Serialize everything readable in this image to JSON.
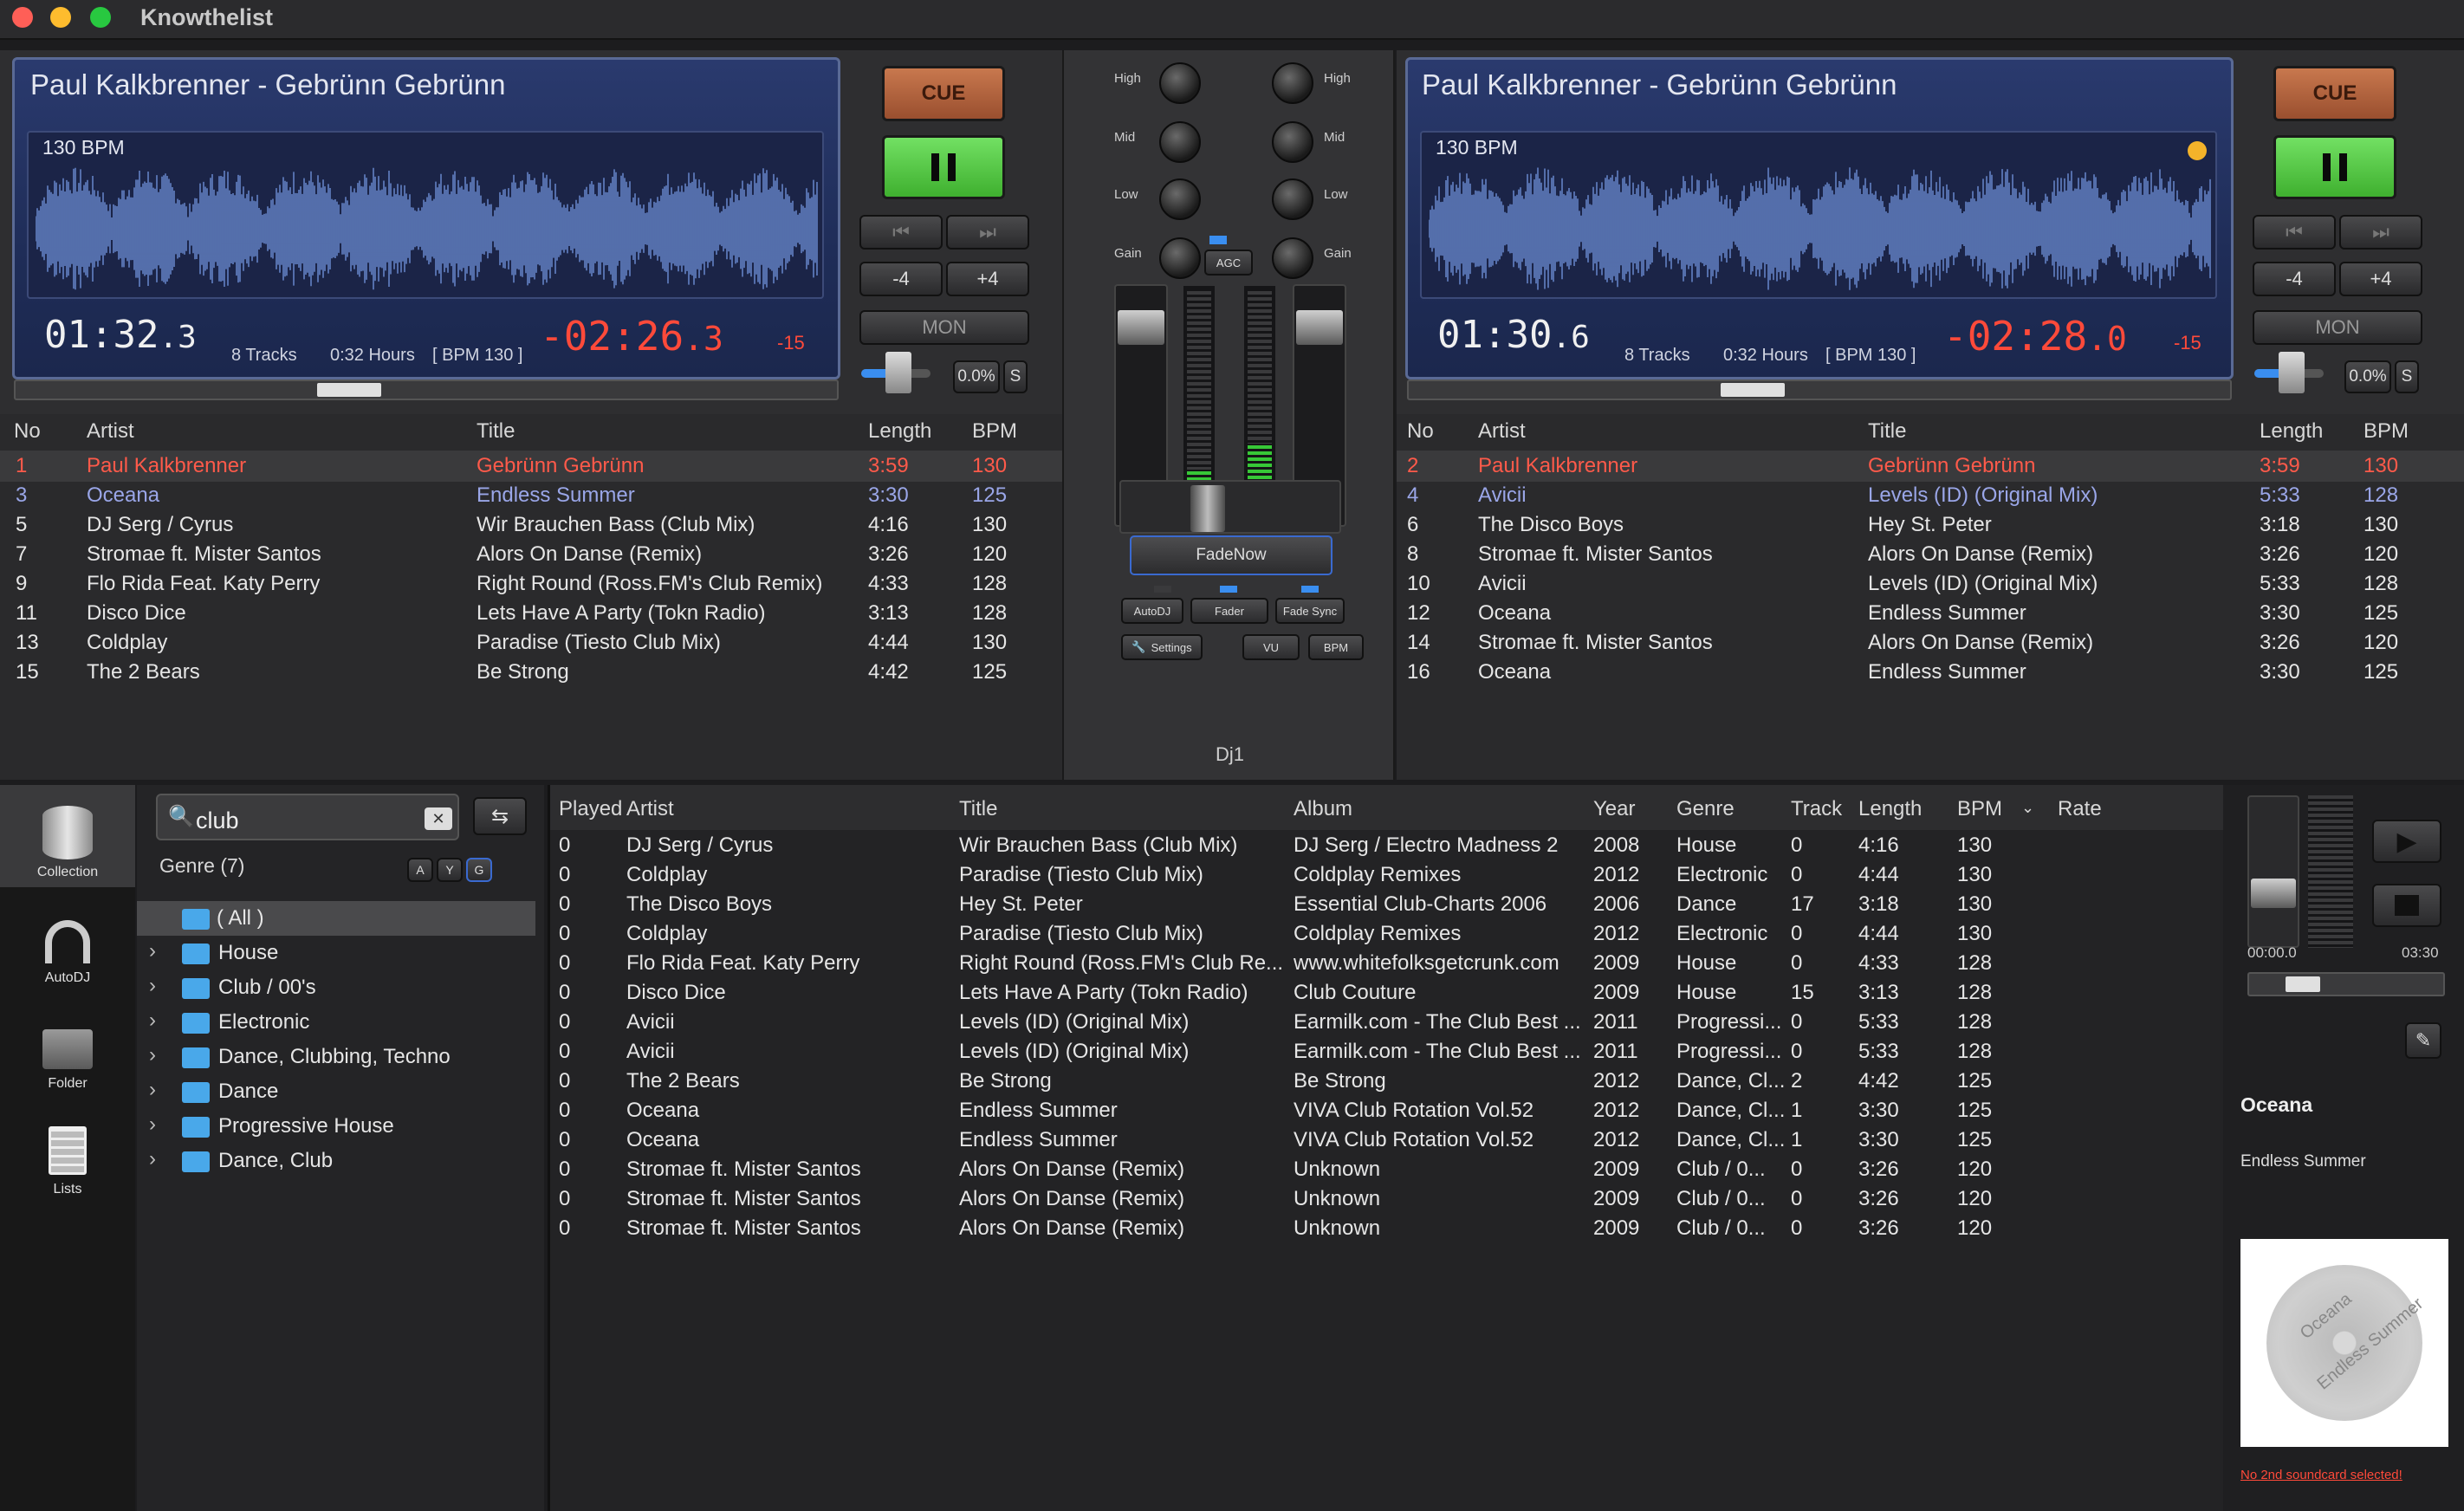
{
  "app": {
    "title": "Knowthelist"
  },
  "colors": {
    "accent_red": "#ff4a3a",
    "lcd_blue": "#22336a",
    "play_green": "#5ccc4c",
    "cue_orange": "#b8643f",
    "folder_blue": "#49a8ea"
  },
  "deck1": {
    "title": "Paul Kalkbrenner - Gebrünn Gebrünn",
    "bpm": "130 BPM",
    "elapsed": "01:32",
    "elapsed_frac": ".3",
    "tracks": "8 Tracks",
    "hours": "0:32 Hours",
    "bpm_tag": "[ BPM 130 ]",
    "remaining": "-02:26",
    "remaining_frac": ".3",
    "pitch_offset": "-15",
    "cue_label": "CUE",
    "minus_label": "-4",
    "plus_label": "+4",
    "mon_label": "MON",
    "pitch_value": "0.0%",
    "sync_label": "S"
  },
  "deck2": {
    "title": "Paul Kalkbrenner - Gebrünn Gebrünn",
    "bpm": "130 BPM",
    "elapsed": "01:30",
    "elapsed_frac": ".6",
    "tracks": "8 Tracks",
    "hours": "0:32 Hours",
    "bpm_tag": "[ BPM 130 ]",
    "remaining": "-02:28",
    "remaining_frac": ".0",
    "pitch_offset": "-15",
    "cue_label": "CUE",
    "minus_label": "-4",
    "plus_label": "+4",
    "mon_label": "MON",
    "pitch_value": "0.0%",
    "sync_label": "S"
  },
  "playlist_headers": {
    "no": "No",
    "artist": "Artist",
    "title": "Title",
    "length": "Length",
    "bpm": "BPM"
  },
  "playlist1": [
    {
      "no": "1",
      "artist": "Paul Kalkbrenner",
      "title": "Gebrünn Gebrünn",
      "length": "3:59",
      "bpm": "130",
      "state": "playing"
    },
    {
      "no": "3",
      "artist": "Oceana",
      "title": "Endless Summer",
      "length": "3:30",
      "bpm": "125",
      "state": "next"
    },
    {
      "no": "5",
      "artist": "DJ Serg / Cyrus",
      "title": "Wir Brauchen Bass (Club Mix)",
      "length": "4:16",
      "bpm": "130",
      "state": ""
    },
    {
      "no": "7",
      "artist": "Stromae ft. Mister Santos",
      "title": "Alors On Danse (Remix)",
      "length": "3:26",
      "bpm": "120",
      "state": ""
    },
    {
      "no": "9",
      "artist": "Flo Rida Feat. Katy Perry",
      "title": "Right Round (Ross.FM's Club Remix)",
      "length": "4:33",
      "bpm": "128",
      "state": ""
    },
    {
      "no": "11",
      "artist": "Disco Dice",
      "title": "Lets Have A Party (Tokn Radio)",
      "length": "3:13",
      "bpm": "128",
      "state": ""
    },
    {
      "no": "13",
      "artist": "Coldplay",
      "title": "Paradise (Tiesto Club Mix)",
      "length": "4:44",
      "bpm": "130",
      "state": ""
    },
    {
      "no": "15",
      "artist": "The 2 Bears",
      "title": "Be Strong",
      "length": "4:42",
      "bpm": "125",
      "state": ""
    }
  ],
  "playlist2": [
    {
      "no": "2",
      "artist": "Paul Kalkbrenner",
      "title": "Gebrünn Gebrünn",
      "length": "3:59",
      "bpm": "130",
      "state": "playing"
    },
    {
      "no": "4",
      "artist": "Avicii",
      "title": "Levels (ID) (Original Mix)",
      "length": "5:33",
      "bpm": "128",
      "state": "next"
    },
    {
      "no": "6",
      "artist": "The Disco Boys",
      "title": "Hey St. Peter",
      "length": "3:18",
      "bpm": "130",
      "state": ""
    },
    {
      "no": "8",
      "artist": "Stromae ft. Mister Santos",
      "title": "Alors On Danse (Remix)",
      "length": "3:26",
      "bpm": "120",
      "state": ""
    },
    {
      "no": "10",
      "artist": "Avicii",
      "title": "Levels (ID) (Original Mix)",
      "length": "5:33",
      "bpm": "128",
      "state": ""
    },
    {
      "no": "12",
      "artist": "Oceana",
      "title": "Endless Summer",
      "length": "3:30",
      "bpm": "125",
      "state": ""
    },
    {
      "no": "14",
      "artist": "Stromae ft. Mister Santos",
      "title": "Alors On Danse (Remix)",
      "length": "3:26",
      "bpm": "120",
      "state": ""
    },
    {
      "no": "16",
      "artist": "Oceana",
      "title": "Endless Summer",
      "length": "3:30",
      "bpm": "125",
      "state": ""
    }
  ],
  "mixer": {
    "high": "High",
    "mid": "Mid",
    "low": "Low",
    "gain": "Gain",
    "agc": "AGC",
    "fadenow": "FadeNow",
    "autodj": "AutoDJ",
    "fader": "Fader",
    "fadesync": "Fade Sync",
    "settings": "Settings",
    "vu": "VU",
    "bpm": "BPM",
    "name": "Dj1"
  },
  "sidebar": [
    {
      "label": "Collection",
      "icon": "database-icon"
    },
    {
      "label": "AutoDJ",
      "icon": "headphones-icon"
    },
    {
      "label": "Folder",
      "icon": "folder-icon"
    },
    {
      "label": "Lists",
      "icon": "list-icon"
    }
  ],
  "search": {
    "value": "club"
  },
  "genre": {
    "label": "Genre  (7)",
    "sort_buttons": [
      "A",
      "Y",
      "G"
    ],
    "items": [
      "( All )",
      "House",
      "Club / 00's",
      "Electronic",
      "Dance, Clubbing, Techno",
      "Dance",
      "Progressive House",
      "Dance, Club"
    ]
  },
  "library_headers": {
    "played": "Played",
    "artist": "Artist",
    "title": "Title",
    "album": "Album",
    "year": "Year",
    "genre": "Genre",
    "track": "Track",
    "length": "Length",
    "bpm": "BPM",
    "rate": "Rate"
  },
  "library": [
    [
      "0",
      "DJ Serg / Cyrus",
      "Wir Brauchen Bass (Club Mix)",
      "DJ Serg / Electro Madness 2",
      "2008",
      "House",
      "0",
      "4:16",
      "130"
    ],
    [
      "0",
      "Coldplay",
      "Paradise (Tiesto Club Mix)",
      "Coldplay Remixes",
      "2012",
      "Electronic",
      "0",
      "4:44",
      "130"
    ],
    [
      "0",
      "The Disco Boys",
      "Hey St. Peter",
      "Essential Club-Charts 2006",
      "2006",
      "Dance",
      "17",
      "3:18",
      "130"
    ],
    [
      "0",
      "Coldplay",
      "Paradise (Tiesto Club Mix)",
      "Coldplay Remixes",
      "2012",
      "Electronic",
      "0",
      "4:44",
      "130"
    ],
    [
      "0",
      "Flo Rida Feat. Katy Perry",
      "Right Round (Ross.FM's Club Re...",
      "www.whitefolksgetcrunk.com",
      "2009",
      "House",
      "0",
      "4:33",
      "128"
    ],
    [
      "0",
      "Disco Dice",
      "Lets Have A Party (Tokn Radio)",
      "Club Couture",
      "2009",
      "House",
      "15",
      "3:13",
      "128"
    ],
    [
      "0",
      "Avicii",
      "Levels (ID) (Original Mix)",
      "Earmilk.com - The Club Best ...",
      "2011",
      "Progressi...",
      "0",
      "5:33",
      "128"
    ],
    [
      "0",
      "Avicii",
      "Levels (ID) (Original Mix)",
      "Earmilk.com - The Club Best ...",
      "2011",
      "Progressi...",
      "0",
      "5:33",
      "128"
    ],
    [
      "0",
      "The 2 Bears",
      "Be Strong",
      "Be Strong",
      "2012",
      "Dance, Cl...",
      "2",
      "4:42",
      "125"
    ],
    [
      "0",
      "Oceana",
      "Endless Summer",
      "VIVA Club Rotation Vol.52",
      "2012",
      "Dance, Cl...",
      "1",
      "3:30",
      "125"
    ],
    [
      "0",
      "Oceana",
      "Endless Summer",
      "VIVA Club Rotation Vol.52",
      "2012",
      "Dance, Cl...",
      "1",
      "3:30",
      "125"
    ],
    [
      "0",
      "Stromae ft. Mister Santos",
      "Alors On Danse (Remix)",
      "Unknown",
      "2009",
      "Club / 0...",
      "0",
      "3:26",
      "120"
    ],
    [
      "0",
      "Stromae ft. Mister Santos",
      "Alors On Danse (Remix)",
      "Unknown",
      "2009",
      "Club / 0...",
      "0",
      "3:26",
      "120"
    ],
    [
      "0",
      "Stromae ft. Mister Santos",
      "Alors On Danse (Remix)",
      "Unknown",
      "2009",
      "Club / 0...",
      "0",
      "3:26",
      "120"
    ]
  ],
  "preview": {
    "time_start": "00:00.0",
    "time_end": "03:30",
    "artist": "Oceana",
    "title": "Endless Summer",
    "cover_line1": "Oceana",
    "cover_line2": "Endless Summer",
    "warning": "No 2nd soundcard selected!"
  }
}
